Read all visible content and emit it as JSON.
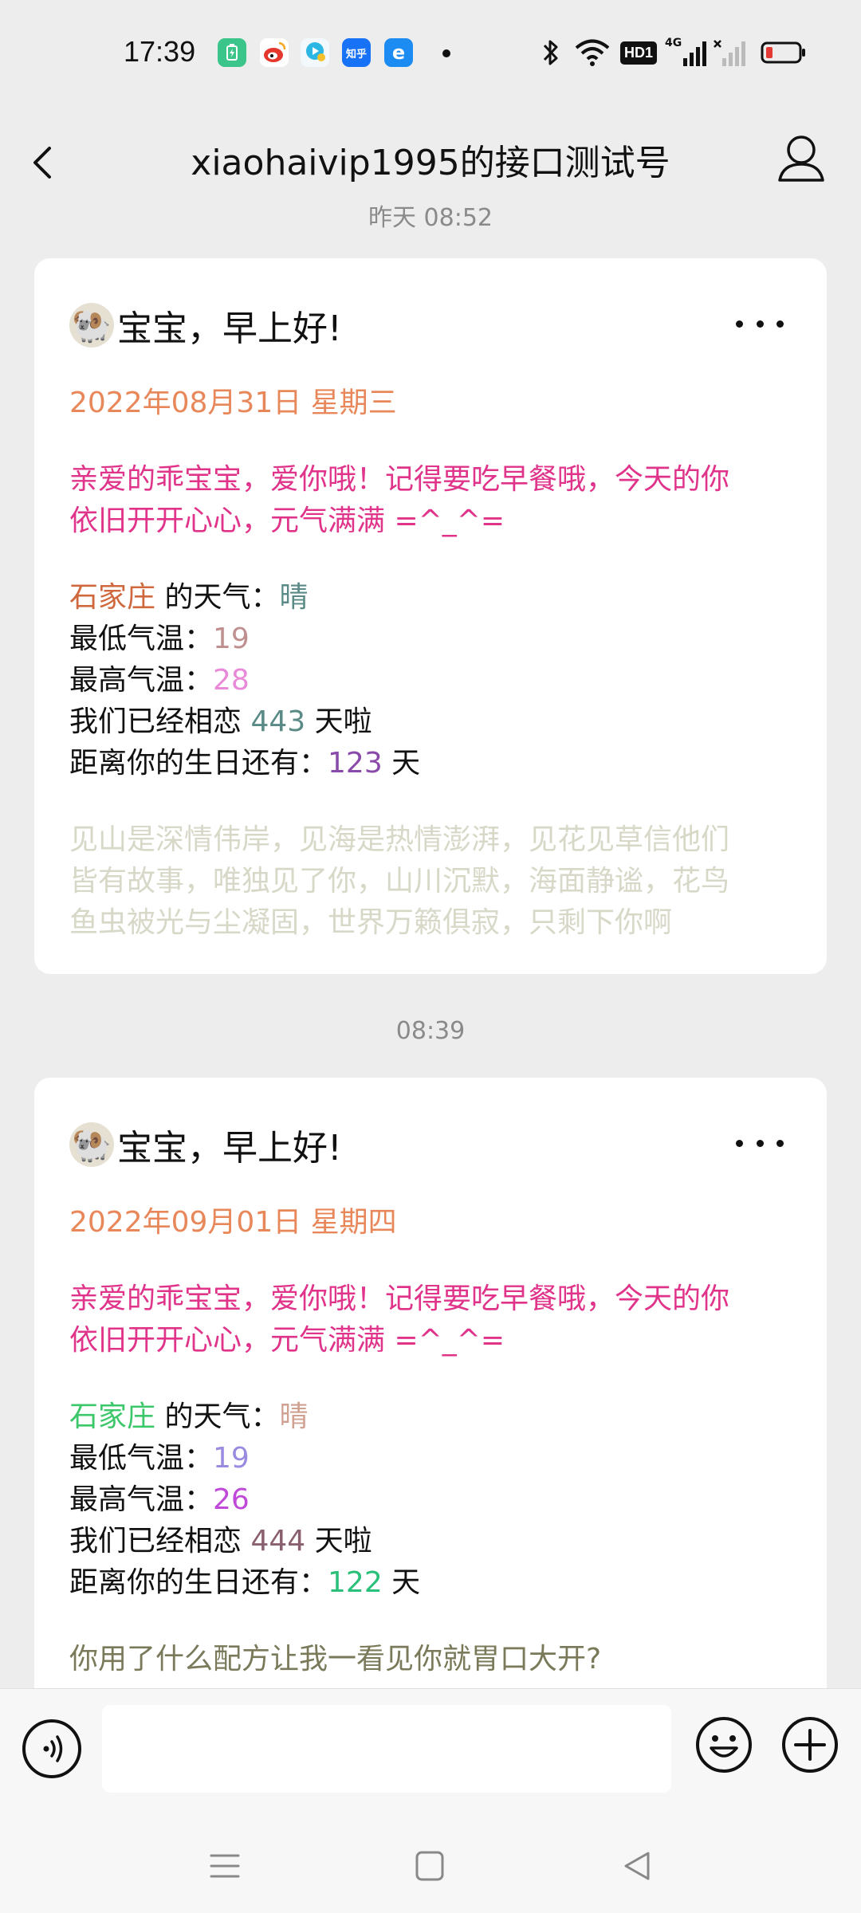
{
  "status_bar": {
    "time": "17:39",
    "apps": [
      {
        "icon": "battery-saver-icon",
        "label": "",
        "color": "#3cc58a"
      },
      {
        "icon": "weibo-icon",
        "label": "",
        "color": "#e6372c"
      },
      {
        "icon": "video-app-icon",
        "label": "",
        "color": "#2bb6e3"
      },
      {
        "icon": "zhihu-icon",
        "label": "知乎",
        "color": "#1772f6"
      },
      {
        "icon": "browser-icon",
        "label": "e",
        "color": "#1c8cf2"
      }
    ],
    "hd_badge": "HD1",
    "network": "4G"
  },
  "nav": {
    "title": "xiaohaivip1995的接口测试号"
  },
  "messages": [
    {
      "time": "昨天 08:52",
      "avatar": "🐏",
      "title": "宝宝，早上好!",
      "date": "2022年08月31日 星期三",
      "love_line1": "亲爱的乖宝宝，爱你哦！记得要吃早餐哦，今天的你",
      "love_line2": "依旧开开心心，元气满满 =^_^=",
      "city": "石家庄",
      "city_color": "#d0683e",
      "weather_label": " 的天气：",
      "weather": "晴",
      "weather_color": "#5a8a86",
      "low_label": "最低气温：",
      "low": "19",
      "low_color": "#c09090",
      "high_label": "最高气温：",
      "high": "28",
      "high_color": "#e88ad8",
      "love_days_pre": "我们已经相恋 ",
      "love_days": "443",
      "love_days_color": "#5a8a86",
      "love_days_post": " 天啦",
      "bday_pre": "距离你的生日还有：",
      "bday": "123",
      "bday_color": "#8a4aaa",
      "bday_post": " 天",
      "quote_lines": [
        "见山是深情伟岸，见海是热情澎湃，见花见草信他们",
        "皆有故事，唯独见了你，山川沉默，海面静谧，花鸟",
        "鱼虫被光与尘凝固，世界万籁俱寂，只剩下你啊"
      ],
      "quote_color": "#d8d8c8"
    },
    {
      "time": "08:39",
      "avatar": "🐏",
      "title": "宝宝，早上好!",
      "date": "2022年09月01日 星期四",
      "love_line1": "亲爱的乖宝宝，爱你哦！记得要吃早餐哦，今天的你",
      "love_line2": "依旧开开心心，元气满满 =^_^=",
      "city": "石家庄",
      "city_color": "#3cc86a",
      "weather_label": " 的天气：",
      "weather": "晴",
      "weather_color": "#d0a090",
      "low_label": "最低气温：",
      "low": "19",
      "low_color": "#9a8ae0",
      "high_label": "最高气温：",
      "high": "26",
      "high_color": "#c04ad8",
      "love_days_pre": "我们已经相恋 ",
      "love_days": "444",
      "love_days_color": "#8a6070",
      "love_days_post": " 天啦",
      "bday_pre": "距离你的生日还有：",
      "bday": "122",
      "bday_color": "#2ac07a",
      "bday_post": " 天",
      "quote_lines": [
        "你用了什么配方让我一看见你就胃口大开?"
      ],
      "quote_color": "#7a7a5a"
    }
  ],
  "input": {
    "placeholder": ""
  }
}
